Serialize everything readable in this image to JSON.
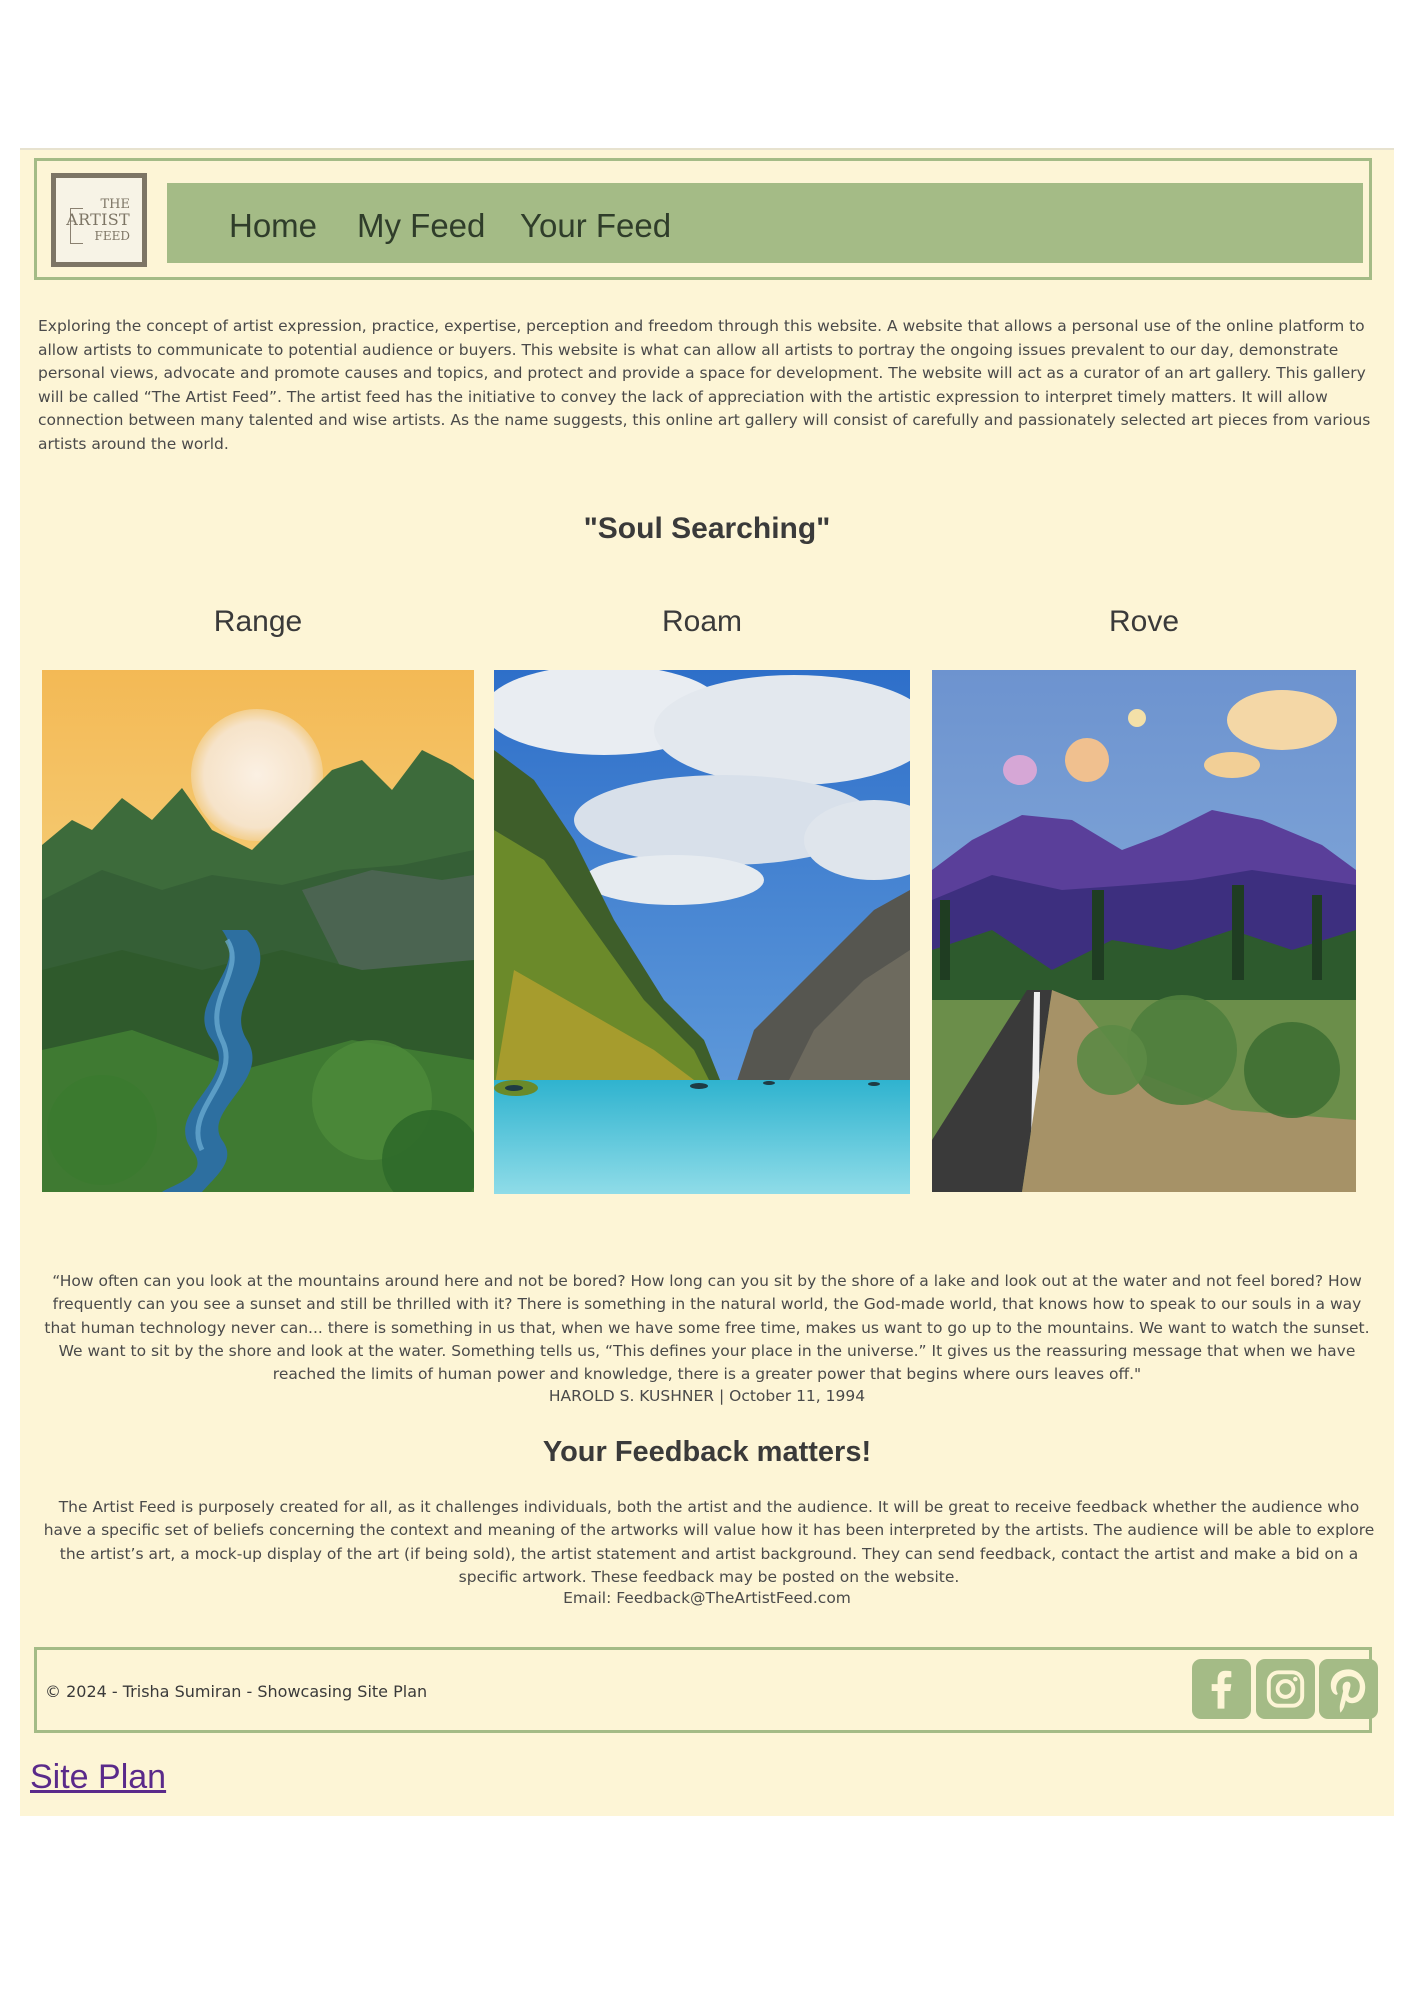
{
  "header": {
    "logo": {
      "line1": "THE",
      "line2": "ARTIST",
      "line3": "FEED"
    },
    "nav": [
      {
        "label": "Home"
      },
      {
        "label": "My Feed"
      },
      {
        "label": "Your Feed"
      }
    ],
    "nav_color": "#a4bb86"
  },
  "intro": "Exploring the concept of artist expression, practice, expertise, perception and freedom through this website. A website that allows a personal use of the online platform to allow artists to communicate to potential audience or buyers. This website is what can allow all artists to portray the ongoing issues prevalent to our day, demonstrate personal views, advocate and promote causes and topics, and protect and provide a space for development. The website will act as a curator of an art gallery. This gallery will be called “The Artist Feed”. The artist feed has the initiative to convey the lack of appreciation with the artistic expression to interpret timely matters. It will allow connection between many talented and wise artists. As the name suggests, this online art gallery will consist of carefully and passionately selected art pieces from various artists around the world.",
  "gallery": {
    "title": "\"Soul Searching\"",
    "artworks": [
      {
        "title": "Range"
      },
      {
        "title": "Roam"
      },
      {
        "title": "Rove"
      }
    ]
  },
  "quote": {
    "text": "“How often can you look at the mountains around here and not be bored? How long can you sit by the shore of a lake and look out at the water and not feel bored? How frequently can you see a sunset and still be thrilled with it? There is something in the natural world, the God-made world, that knows how to speak to our souls in a way that human technology never can... there is something in us that, when we have some free time, makes us want to go up to the mountains. We want to watch the sunset. We want to sit by the shore and look at the water. Something tells us, “This defines your place in the universe.” It gives us the reassuring message that when we have reached the limits of human power and knowledge, there is a greater power that begins where ours leaves off.\"",
    "author": "HAROLD S. KUSHNER | October 11, 1994"
  },
  "feedback": {
    "title": "Your Feedback matters!",
    "text": "The Artist Feed is purposely created for all, as it challenges individuals, both the artist and the audience. It will be great to receive feedback whether the audience who have a specific set of beliefs concerning the context and meaning of the artworks will value how it has been interpreted by the artists. The audience will be able to explore the artist’s art, a mock-up display of the art (if being sold), the artist statement and artist background. They can send feedback, contact the artist and make a bid on a specific artwork. These feedback may be posted on the website.",
    "email": "Email: Feedback@TheArtistFeed.com"
  },
  "footer": {
    "copyright": "© 2024 - Trisha Sumiran - Showcasing Site Plan",
    "social": [
      "facebook-icon",
      "instagram-icon",
      "pinterest-icon"
    ]
  },
  "site_plan_link": "Site Plan"
}
